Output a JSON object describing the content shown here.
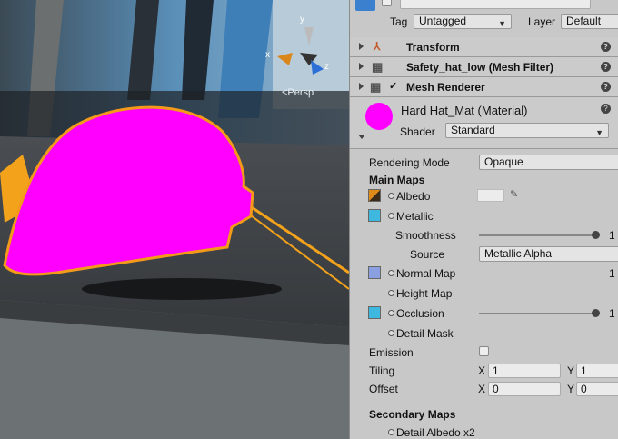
{
  "scene": {
    "persp_label": "<Persp",
    "gizmo": {
      "x": "x",
      "y": "y",
      "z": "z"
    }
  },
  "inspector": {
    "tag_label": "Tag",
    "tag_value": "Untagged",
    "layer_label": "Layer",
    "layer_value": "Default",
    "components": {
      "transform": "Transform",
      "mesh_filter": "Safety_hat_low (Mesh Filter)",
      "mesh_renderer": "Mesh Renderer"
    },
    "material": {
      "name": "Hard Hat_Mat (Material)",
      "shader_label": "Shader",
      "shader_value": "Standard",
      "color": "#ff00ff"
    },
    "props": {
      "rendering_mode_label": "Rendering Mode",
      "rendering_mode_value": "Opaque",
      "main_maps": "Main Maps",
      "albedo": "Albedo",
      "metallic": "Metallic",
      "smoothness": "Smoothness",
      "smoothness_value": "1",
      "source_label": "Source",
      "source_value": "Metallic Alpha",
      "normal_map": "Normal Map",
      "normal_value": "1",
      "height_map": "Height Map",
      "occlusion": "Occlusion",
      "occlusion_value": "1",
      "detail_mask": "Detail Mask",
      "emission": "Emission",
      "tiling": "Tiling",
      "offset": "Offset",
      "x": "X",
      "y": "Y",
      "tiling_x": "1",
      "tiling_y": "1",
      "offset_x": "0",
      "offset_y": "0",
      "secondary_maps": "Secondary Maps",
      "detail_albedo": "Detail Albedo x2"
    }
  }
}
